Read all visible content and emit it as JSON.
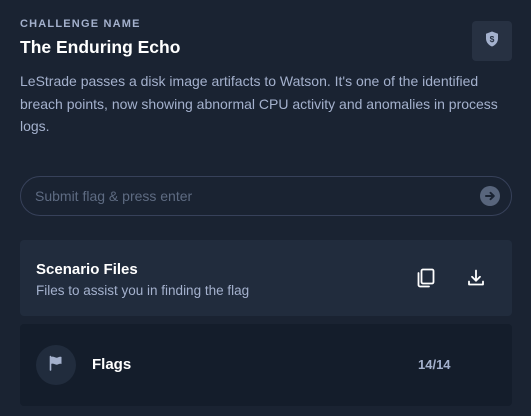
{
  "challenge": {
    "label": "CHALLENGE NAME",
    "title": "The Enduring Echo",
    "description": "LeStrade passes a disk image artifacts to Watson. It's one of the identified breach points, now showing abnormal CPU activity and anomalies in process logs."
  },
  "flag_input": {
    "placeholder": "Submit flag & press enter",
    "value": ""
  },
  "scenario_files": {
    "title": "Scenario Files",
    "subtitle": "Files to assist you in finding the flag"
  },
  "flags": {
    "title": "Flags",
    "count": "14/14"
  },
  "icons": {
    "badge": "shield-dollar-icon",
    "submit": "arrow-right-circle-icon",
    "copy": "copy-icon",
    "download": "download-icon",
    "flags": "flag-icon"
  },
  "colors": {
    "background": "#1a2332",
    "card": "#212c3d",
    "card_dark": "#141d2b",
    "text_muted": "#a4b1cd"
  }
}
